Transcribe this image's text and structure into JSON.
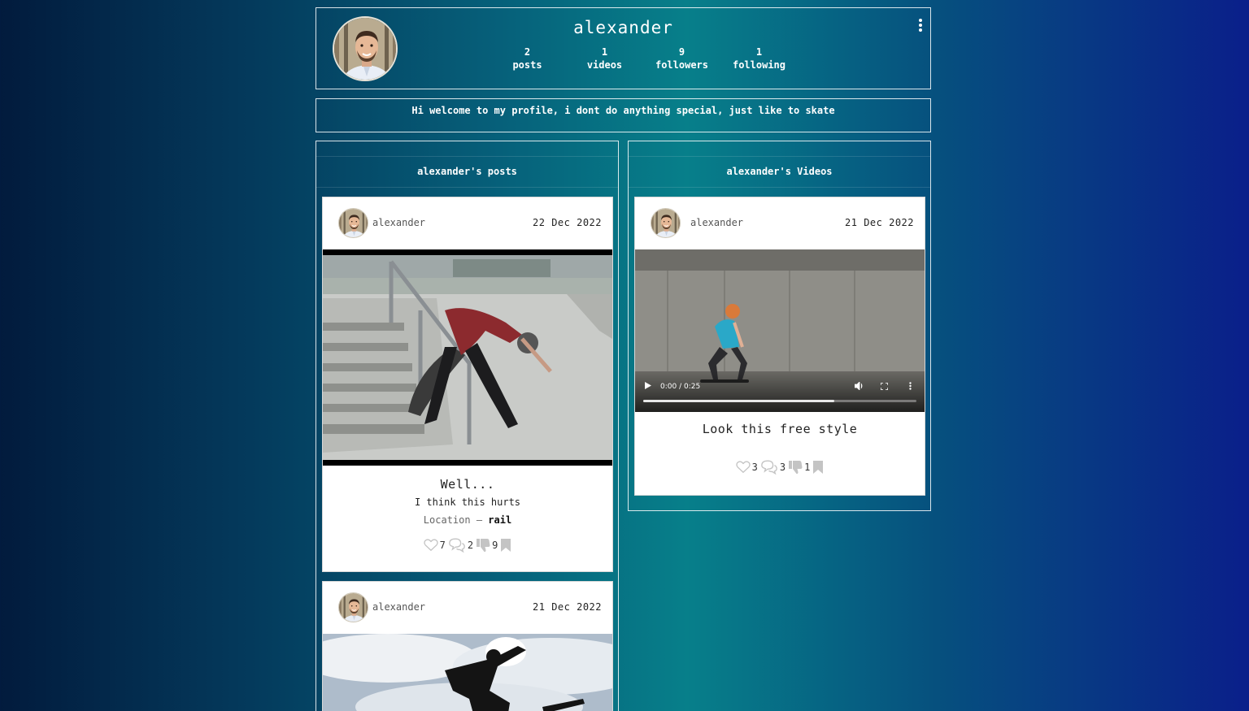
{
  "profile": {
    "username": "alexander",
    "stats": [
      {
        "count": "2",
        "label": "posts"
      },
      {
        "count": "1",
        "label": "videos"
      },
      {
        "count": "9",
        "label": "followers"
      },
      {
        "count": "1",
        "label": "following"
      }
    ],
    "bio": "Hi welcome to my profile, i dont do anything special, just like to skate"
  },
  "posts_column": {
    "title": "alexander's posts",
    "posts": [
      {
        "user": "alexander",
        "date": "22 Dec 2022",
        "title": "Well...",
        "description": "I think this hurts",
        "location_label": "Location –",
        "location_value": "rail",
        "likes": "7",
        "comments": "2",
        "dislikes": "9"
      },
      {
        "user": "alexander",
        "date": "21 Dec 2022"
      }
    ]
  },
  "videos_column": {
    "title": "alexander's Videos",
    "videos": [
      {
        "user": "alexander",
        "date": "21 Dec 2022",
        "time": "0:00 / 0:25",
        "progress_percent": 70,
        "title": "Look this free style",
        "likes": "3",
        "comments": "3",
        "dislikes": "1"
      }
    ]
  },
  "icons": {
    "menu": "more-vertical-icon",
    "like": "heart-icon",
    "comment": "comment-icon",
    "dislike": "thumbs-down-icon",
    "save": "bookmark-icon",
    "play": "play-icon",
    "volume": "volume-icon",
    "fullscreen": "fullscreen-icon"
  },
  "colors": {
    "icon_gray": "#c4c4c4",
    "card_bg": "#ffffff"
  }
}
